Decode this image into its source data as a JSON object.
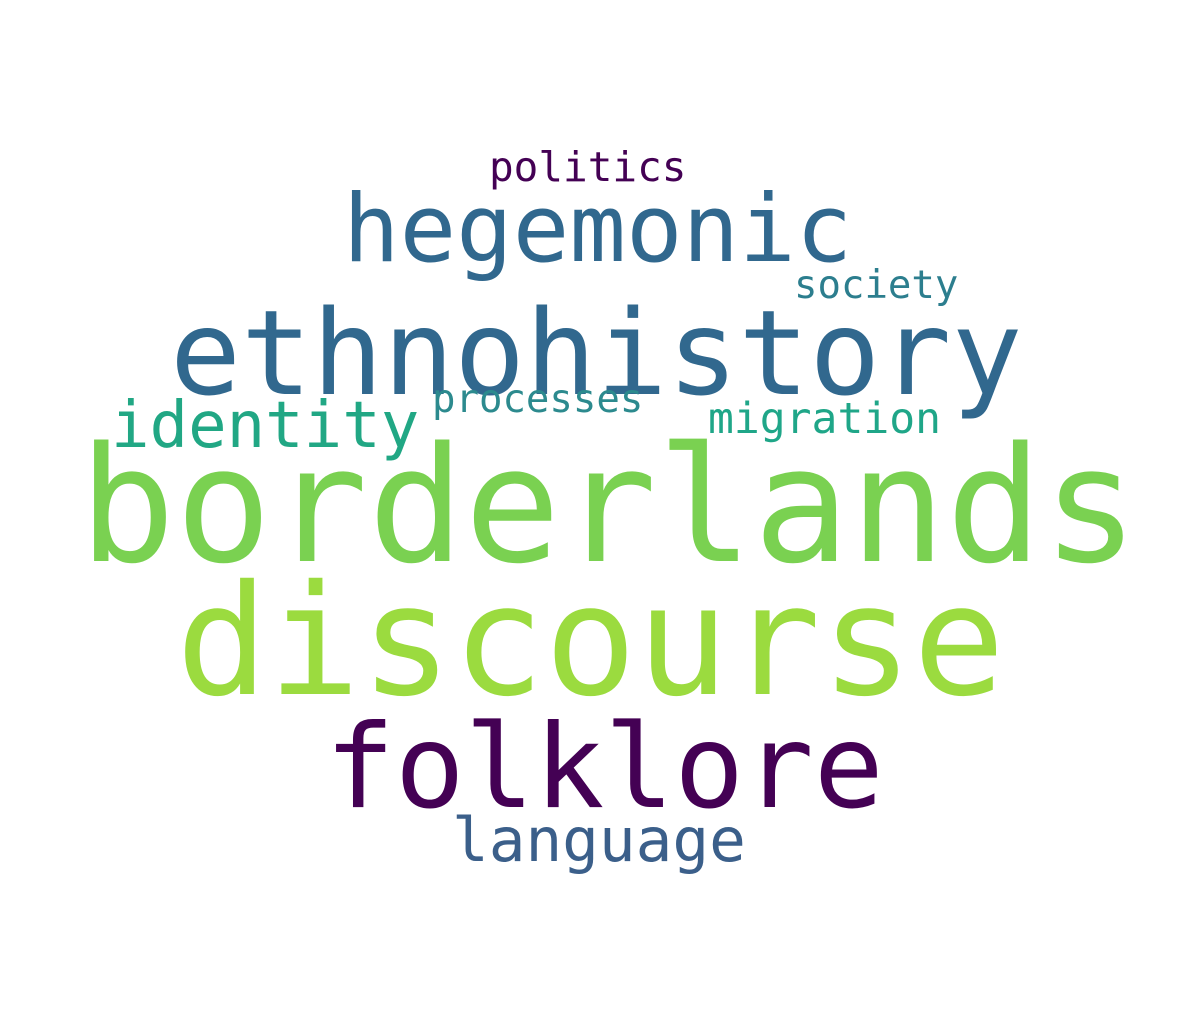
{
  "words": {
    "politics": {
      "text": "politics",
      "color": "#440154"
    },
    "hegemonic": {
      "text": "hegemonic",
      "color": "#31688e"
    },
    "society": {
      "text": "society",
      "color": "#2c7e8e"
    },
    "ethnohistory": {
      "text": "ethnohistory",
      "color": "#31688e"
    },
    "identity": {
      "text": "identity",
      "color": "#21a784"
    },
    "processes": {
      "text": "processes",
      "color": "#2c8a8e"
    },
    "migration": {
      "text": "migration",
      "color": "#1fa688"
    },
    "borderlands": {
      "text": "borderlands",
      "color": "#7ad151"
    },
    "discourse": {
      "text": "discourse",
      "color": "#9bdb3f"
    },
    "folklore": {
      "text": "folklore",
      "color": "#440154"
    },
    "language": {
      "text": "language",
      "color": "#3b5f8a"
    }
  }
}
